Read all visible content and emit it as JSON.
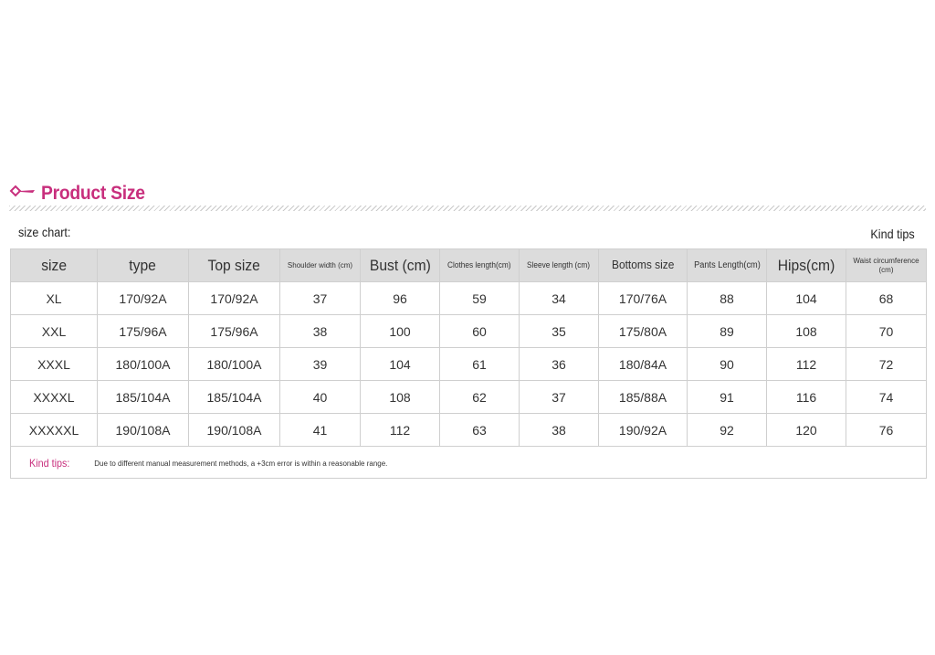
{
  "header": {
    "title": "Product Size",
    "icon": "pink-ribbon-icon",
    "accent_color": "#c82f7d"
  },
  "chart_label": "size chart:",
  "tips_label": "Kind tips",
  "table": {
    "columns": [
      "size",
      "type",
      "Top size",
      "Shoulder width (cm)",
      "Bust (cm)",
      "Clothes length(cm)",
      "Sleeve length (cm)",
      "Bottoms size",
      "Pants Length(cm)",
      "Hips(cm)",
      "Waist circumference (cm)"
    ],
    "rows": [
      [
        "XL",
        "170/92A",
        "170/92A",
        "37",
        "96",
        "59",
        "34",
        "170/76A",
        "88",
        "104",
        "68"
      ],
      [
        "XXL",
        "175/96A",
        "175/96A",
        "38",
        "100",
        "60",
        "35",
        "175/80A",
        "89",
        "108",
        "70"
      ],
      [
        "XXXL",
        "180/100A",
        "180/100A",
        "39",
        "104",
        "61",
        "36",
        "180/84A",
        "90",
        "112",
        "72"
      ],
      [
        "XXXXL",
        "185/104A",
        "185/104A",
        "40",
        "108",
        "62",
        "37",
        "185/88A",
        "91",
        "116",
        "74"
      ],
      [
        "XXXXXL",
        "190/108A",
        "190/108A",
        "41",
        "112",
        "63",
        "38",
        "190/92A",
        "92",
        "120",
        "76"
      ]
    ],
    "header_bg": "#dcdcdc"
  },
  "tips": {
    "label": "Kind tips:",
    "text": "Due to different manual measurement methods, a +3cm error is within a reasonable range."
  }
}
